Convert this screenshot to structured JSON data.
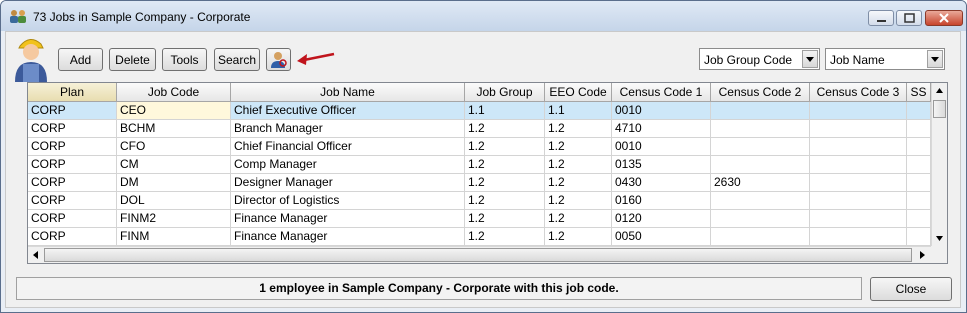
{
  "window": {
    "title": "73 Jobs in Sample Company - Corporate"
  },
  "toolbar": {
    "add_label": "Add",
    "delete_label": "Delete",
    "tools_label": "Tools",
    "search_label": "Search",
    "group_combo_value": "Job Group Code",
    "sort_combo_value": "Job Name"
  },
  "grid": {
    "columns": [
      "Plan",
      "Job Code",
      "Job Name",
      "Job Group",
      "EEO Code",
      "Census Code 1",
      "Census Code 2",
      "Census Code 3",
      "SS"
    ],
    "rows": [
      [
        "CORP",
        "CEO",
        "Chief Executive Officer",
        "1.1",
        "1.1",
        "0010",
        "",
        "",
        ""
      ],
      [
        "CORP",
        "BCHM",
        "Branch Manager",
        "1.2",
        "1.2",
        "4710",
        "",
        "",
        ""
      ],
      [
        "CORP",
        "CFO",
        "Chief Financial Officer",
        "1.2",
        "1.2",
        "0010",
        "",
        "",
        ""
      ],
      [
        "CORP",
        "CM",
        "Comp Manager",
        "1.2",
        "1.2",
        "0135",
        "",
        "",
        ""
      ],
      [
        "CORP",
        "DM",
        "Designer Manager",
        "1.2",
        "1.2",
        "0430",
        "2630",
        "",
        ""
      ],
      [
        "CORP",
        "DOL",
        "Director of Logistics",
        "1.2",
        "1.2",
        "0160",
        "",
        "",
        ""
      ],
      [
        "CORP",
        "FINM2",
        "Finance Manager",
        "1.2",
        "1.2",
        "0120",
        "",
        "",
        ""
      ],
      [
        "CORP",
        "FINM",
        "Finance Manager",
        "1.2",
        "1.2",
        "0050",
        "",
        "",
        ""
      ]
    ]
  },
  "status": {
    "text": "1 employee in Sample Company - Corporate with this job code."
  },
  "footer": {
    "close_label": "Close"
  },
  "colors": {
    "selected_row": "#cde7f8",
    "current_cell": "#fff8dc",
    "arrow": "#c0141c"
  }
}
